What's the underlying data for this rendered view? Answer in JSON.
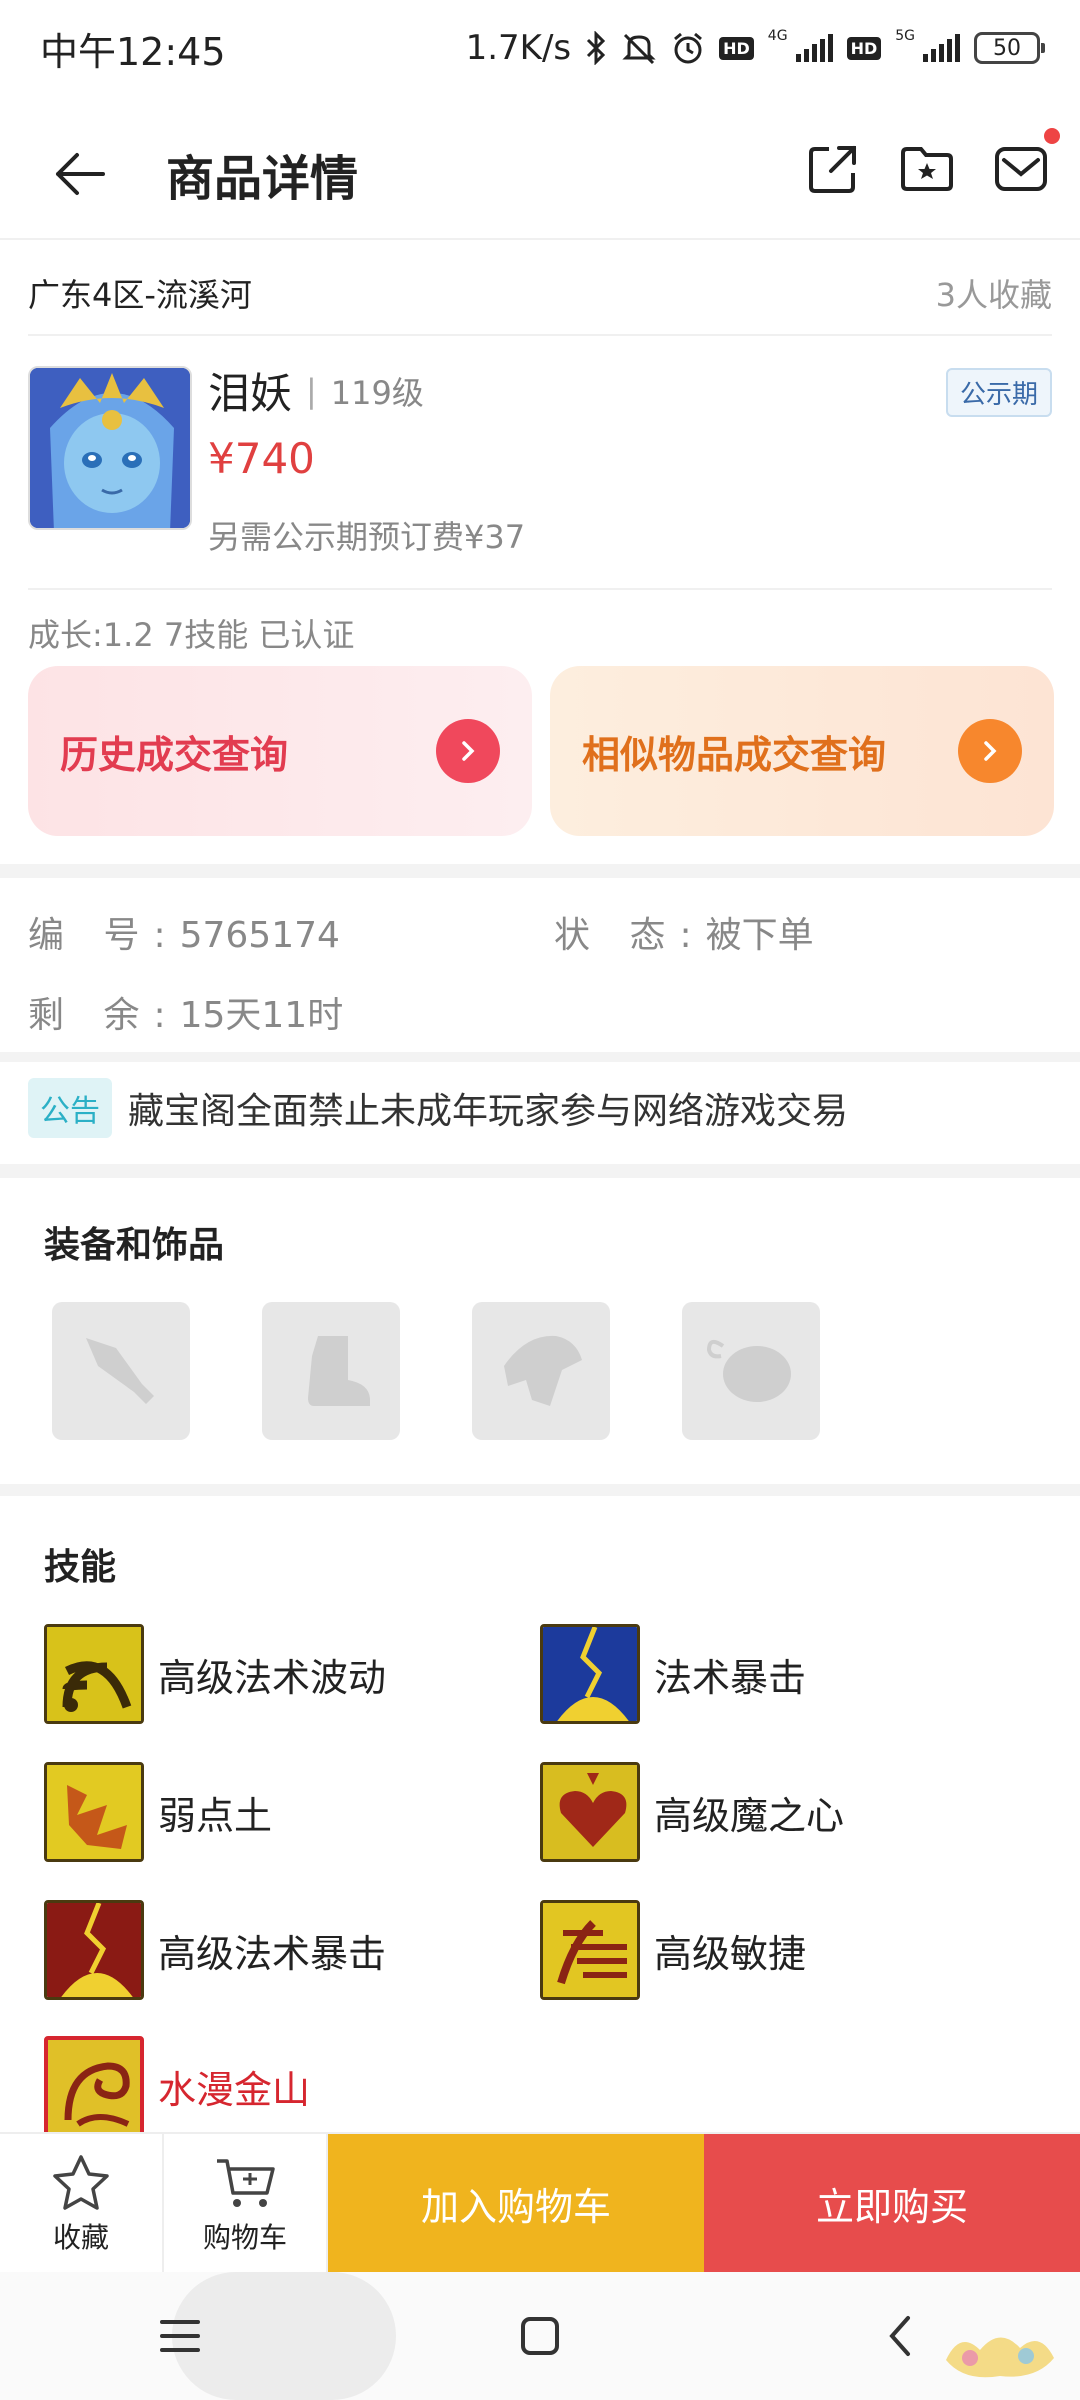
{
  "status_bar": {
    "time": "中午12:45",
    "network_speed": "1.7K/s",
    "sim1_type": "4G",
    "sim2_type": "5G",
    "hd1": "HD",
    "hd2": "HD",
    "battery": "50"
  },
  "header": {
    "title": "商品详情"
  },
  "listing": {
    "server": "广东4区-流溪河",
    "favorites": "3人收藏",
    "name": "泪妖",
    "level": "119级",
    "price": "¥740",
    "deposit_note": "另需公示期预订费¥37",
    "period_badge": "公示期",
    "growth_info": "成长:1.2 7技能 已认证"
  },
  "queries": {
    "history": "历史成交查询",
    "similar": "相似物品成交查询"
  },
  "details": {
    "id_label": "编 号:",
    "id_value": "5765174",
    "status_label": "状 态:",
    "status_value": "被下单",
    "remaining_label": "剩 余:",
    "remaining_value": "15天11时"
  },
  "notice": {
    "tag": "公告",
    "text": "藏宝阁全面禁止未成年玩家参与网络游戏交易"
  },
  "equipment": {
    "title": "装备和饰品",
    "slots": [
      "weapon-slot-icon",
      "boots-slot-icon",
      "armor-slot-icon",
      "accessory-slot-icon"
    ]
  },
  "skills": {
    "title": "技能",
    "items": [
      {
        "name": "高级法术波动",
        "icon": "wave-icon"
      },
      {
        "name": "法术暴击",
        "icon": "crit-icon"
      },
      {
        "name": "弱点土",
        "icon": "weak-earth-icon"
      },
      {
        "name": "高级魔之心",
        "icon": "heart-icon"
      },
      {
        "name": "高级法术暴击",
        "icon": "adv-crit-icon"
      },
      {
        "name": "高级敏捷",
        "icon": "agility-icon"
      },
      {
        "name": "水漫金山",
        "icon": "flood-icon"
      }
    ]
  },
  "bottom_bar": {
    "favorite": "收藏",
    "cart": "购物车",
    "add_to_cart": "加入购物车",
    "buy_now": "立即购买"
  },
  "colors": {
    "price": "#e04040",
    "cart_button": "#f0b41e",
    "buy_button": "#e74c4c",
    "special_skill": "#d6262f"
  }
}
